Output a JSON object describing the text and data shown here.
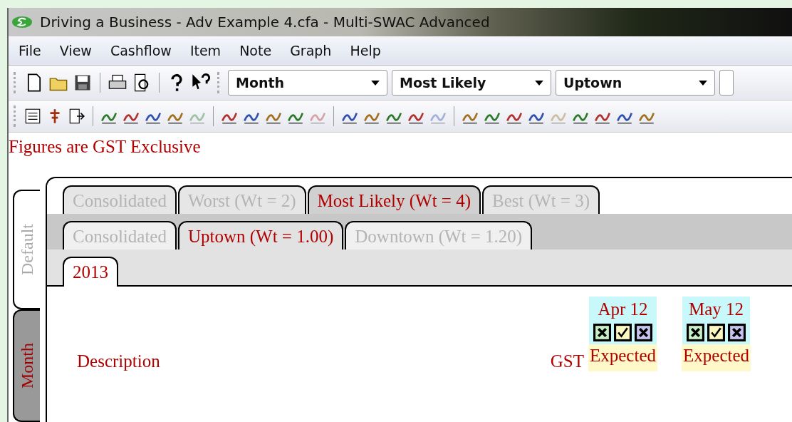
{
  "window": {
    "title": "Driving a Business -  Adv Example 4.cfa - Multi-SWAC Advanced"
  },
  "menu": [
    "File",
    "View",
    "Cashflow",
    "Item",
    "Note",
    "Graph",
    "Help"
  ],
  "toolbar": {
    "dropdowns": [
      {
        "value": "Month"
      },
      {
        "value": "Most Likely"
      },
      {
        "value": "Uptown"
      }
    ]
  },
  "notice": "Figures are GST Exclusive",
  "side_tabs": [
    {
      "label": "Default",
      "selected": false
    },
    {
      "label": "Month",
      "selected": true
    }
  ],
  "scenario_tabs": [
    {
      "label": "Consolidated",
      "selected": false
    },
    {
      "label": "Worst (Wt = 2)",
      "selected": false
    },
    {
      "label": "Most Likely (Wt = 4)",
      "selected": true
    },
    {
      "label": "Best (Wt = 3)",
      "selected": false
    }
  ],
  "location_tabs": [
    {
      "label": "Consolidated",
      "selected": false
    },
    {
      "label": "Uptown (Wt = 1.00)",
      "selected": true
    },
    {
      "label": "Downtown (Wt = 1.20)",
      "selected": false
    }
  ],
  "year_tabs": [
    {
      "label": "2013",
      "selected": true
    }
  ],
  "grid": {
    "description_header": "Description",
    "gst_header": "GST",
    "columns": [
      {
        "period": "Apr 12",
        "flags": [
          {
            "kind": "cross",
            "color": "#c6efc6"
          },
          {
            "kind": "tick",
            "color": "#fbf7c0"
          },
          {
            "kind": "cross",
            "color": "#c4c4ee"
          }
        ],
        "status": "Expected"
      },
      {
        "period": "May 12",
        "flags": [
          {
            "kind": "cross",
            "color": "#c6efc6"
          },
          {
            "kind": "tick",
            "color": "#fbf7c0"
          },
          {
            "kind": "cross",
            "color": "#c4c4ee"
          }
        ],
        "status": "Expected"
      }
    ]
  }
}
